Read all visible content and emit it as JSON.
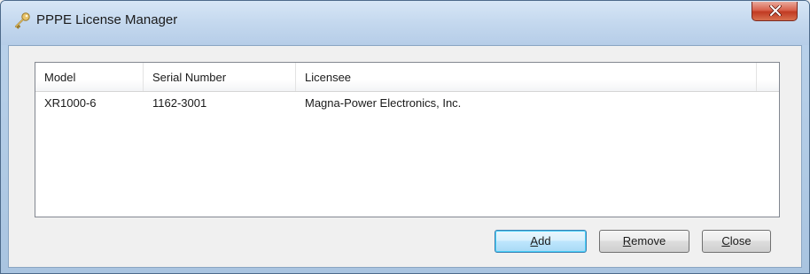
{
  "window": {
    "title": "PPPE License Manager",
    "icon": "key-icon",
    "close_glyph": "x"
  },
  "list": {
    "columns": [
      "Model",
      "Serial Number",
      "Licensee"
    ],
    "rows": [
      [
        "XR1000-6",
        "1162-3001",
        "Magna-Power Electronics, Inc."
      ]
    ]
  },
  "buttons": {
    "add": {
      "accel": "A",
      "rest": "dd"
    },
    "remove": {
      "accel": "R",
      "rest": "emove"
    },
    "close": {
      "accel": "C",
      "rest": "lose"
    }
  },
  "colors": {
    "titlebar": "#c4d8ee",
    "close_button": "#c13a22",
    "default_button_border": "#3c7fb1"
  }
}
